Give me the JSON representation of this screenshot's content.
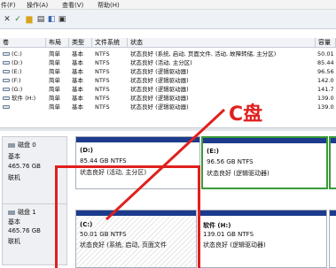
{
  "menu": {
    "items": [
      "件(F)",
      "操作(A)",
      "查看(V)",
      "帮助(H)"
    ]
  },
  "toolbar": {
    "icons": [
      "back-icon",
      "forward-icon",
      "properties-icon",
      "help-icon",
      "refresh-icon",
      "disk-icon"
    ]
  },
  "columns": [
    "卷",
    "布局",
    "类型",
    "文件系统",
    "状态",
    "容量"
  ],
  "volumes": [
    {
      "name": "(C:)",
      "layout": "简单",
      "type": "基本",
      "fs": "NTFS",
      "status": "状态良好 (系统, 启动, 页面文件, 活动, 故障转储, 主分区)",
      "capacity": "50.01"
    },
    {
      "name": "(D:)",
      "layout": "简单",
      "type": "基本",
      "fs": "NTFS",
      "status": "状态良好 (活动, 主分区)",
      "capacity": "85.44"
    },
    {
      "name": "(E:)",
      "layout": "简单",
      "type": "基本",
      "fs": "NTFS",
      "status": "状态良好 (逻辑驱动器)",
      "capacity": "96.56"
    },
    {
      "name": "(F:)",
      "layout": "简单",
      "type": "基本",
      "fs": "NTFS",
      "status": "状态良好 (逻辑驱动器)",
      "capacity": "142.0"
    },
    {
      "name": "(G:)",
      "layout": "简单",
      "type": "基本",
      "fs": "NTFS",
      "status": "状态良好 (逻辑驱动器)",
      "capacity": "141.7"
    },
    {
      "name": "软件 (H:)",
      "layout": "简单",
      "type": "基本",
      "fs": "NTFS",
      "status": "状态良好 (逻辑驱动器)",
      "capacity": "139.0"
    },
    {
      "name": "",
      "layout": "简单",
      "type": "基本",
      "fs": "NTFS",
      "status": "状态良好 (逻辑驱动器)",
      "capacity": "139.0"
    }
  ],
  "disk0": {
    "name": "磁盘 0",
    "type": "基本",
    "size": "465.76 GB",
    "state": "联机",
    "parts": [
      {
        "label": "(D:)",
        "size": "85.44 GB NTFS",
        "status": "状态良好 (活动, 主分区)"
      },
      {
        "label": "(E:)",
        "size": "96.56 GB NTFS",
        "status": "状态良好 (逻辑驱动器)"
      }
    ]
  },
  "disk1": {
    "name": "磁盘 1",
    "type": "基本",
    "size": "465.76 GB",
    "state": "联机",
    "parts": [
      {
        "label": "(C:)",
        "size": "50.01 GB NTFS",
        "status": "状态良好 (系统, 启动, 页面文件"
      },
      {
        "label": "软件 (H:)",
        "size": "139.01 GB NTFS",
        "status": "状态良好 (逻辑驱动器)"
      }
    ]
  },
  "annotation": {
    "text": "C盘",
    "color": "#e0201e"
  }
}
